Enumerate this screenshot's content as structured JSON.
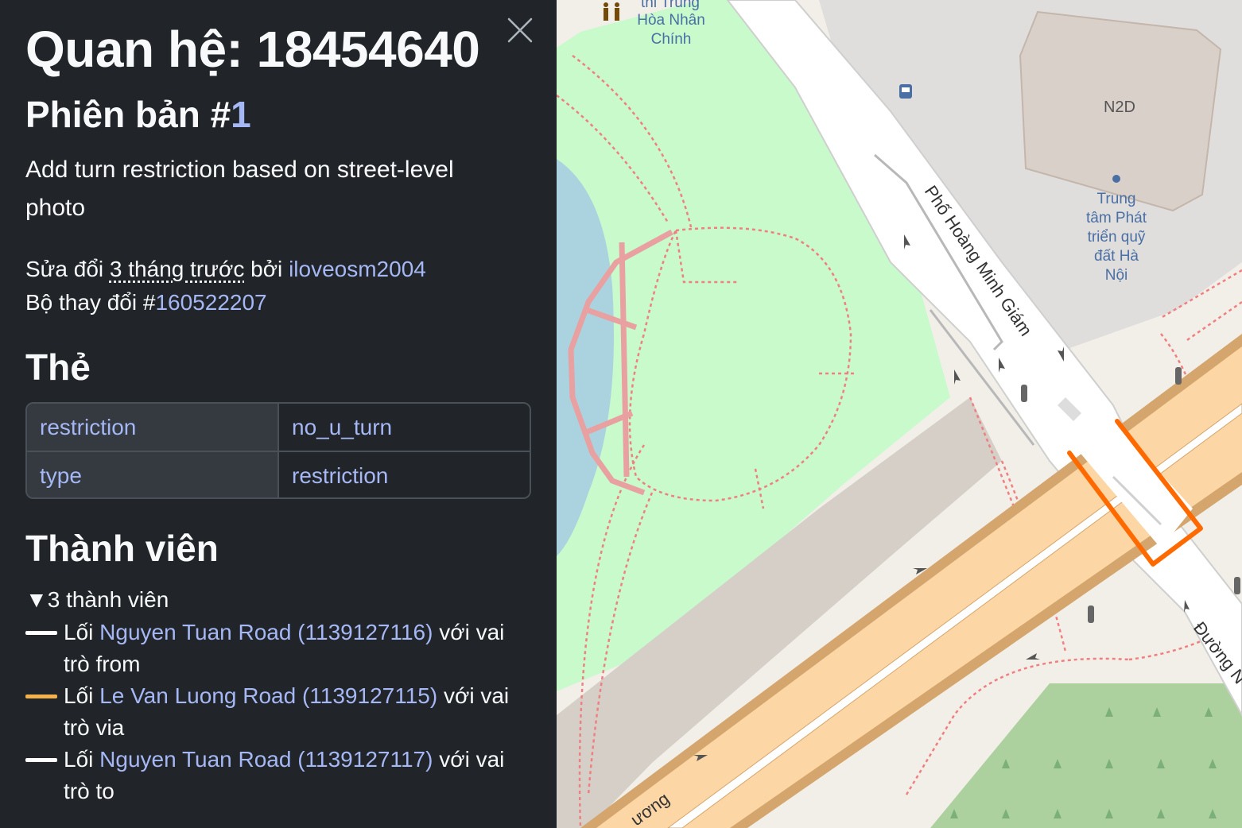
{
  "sidebar": {
    "title": "Quan hệ: 18454640",
    "version_prefix": "Phiên bản #",
    "version_number": "1",
    "comment": "Add turn restriction based on street-level photo",
    "edited_prefix": "Sửa đổi ",
    "edited_time": "3 tháng trước",
    "edited_by": " bởi ",
    "user": "iloveosm2004",
    "changeset_prefix": "Bộ thay đổi #",
    "changeset_id": "160522207",
    "tags_heading": "Thẻ",
    "tags": [
      {
        "key": "restriction",
        "value": "no_u_turn"
      },
      {
        "key": "type",
        "value": "restriction"
      }
    ],
    "members_heading": "Thành viên",
    "members_summary": "3 thành viên",
    "members": [
      {
        "prefix": "Lối ",
        "link": "Nguyen Tuan Road (1139127116)",
        "suffix": " với vai trò from",
        "swatch_color": "#ffffff"
      },
      {
        "prefix": "Lối ",
        "link": "Le Van Luong Road (1139127115)",
        "suffix": " với vai trò via",
        "swatch_color": "#f2b14a"
      },
      {
        "prefix": "Lối ",
        "link": "Nguyen Tuan Road (1139127117)",
        "suffix": " với vai trò to",
        "swatch_color": "#ffffff"
      }
    ]
  },
  "map": {
    "labels": {
      "poi_top": "thi Trung",
      "poi_top2": "Hòa Nhân",
      "poi_top3": "Chính",
      "building": "N2D",
      "poi_right": [
        "Trung",
        "tâm Phát",
        "triển quỹ",
        "đất Hà",
        "Nội"
      ],
      "street_1": "Phố Hoàng Minh Giám",
      "street_2": "Đường N",
      "street_3": "ương"
    },
    "colors": {
      "park": "#c8facc",
      "water": "#aad3df",
      "road_primary": "#fcd6a4",
      "road_edge": "#d4a66e",
      "highlight": "#ff6a00",
      "forest": "#add19e",
      "building": "#d9d0c9",
      "parking_gray": "#dddddd",
      "label_blue": "#4a6fa5"
    }
  }
}
